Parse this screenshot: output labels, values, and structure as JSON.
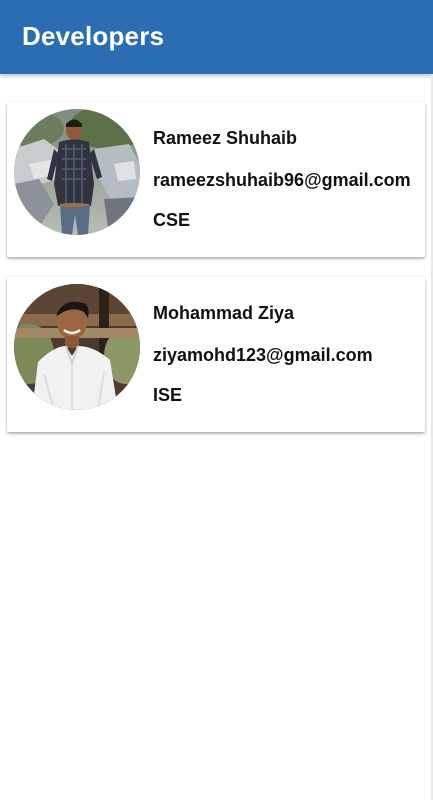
{
  "app_bar": {
    "title": "Developers",
    "color": "#2a6db3"
  },
  "developers": [
    {
      "name": "Rameez Shuhaib",
      "email": "rameezshuhaib96@gmail.com",
      "department": "CSE",
      "avatar_icon": "user-photo"
    },
    {
      "name": "Mohammad Ziya",
      "email": "ziyamohd123@gmail.com",
      "department": "ISE",
      "avatar_icon": "user-photo"
    }
  ]
}
